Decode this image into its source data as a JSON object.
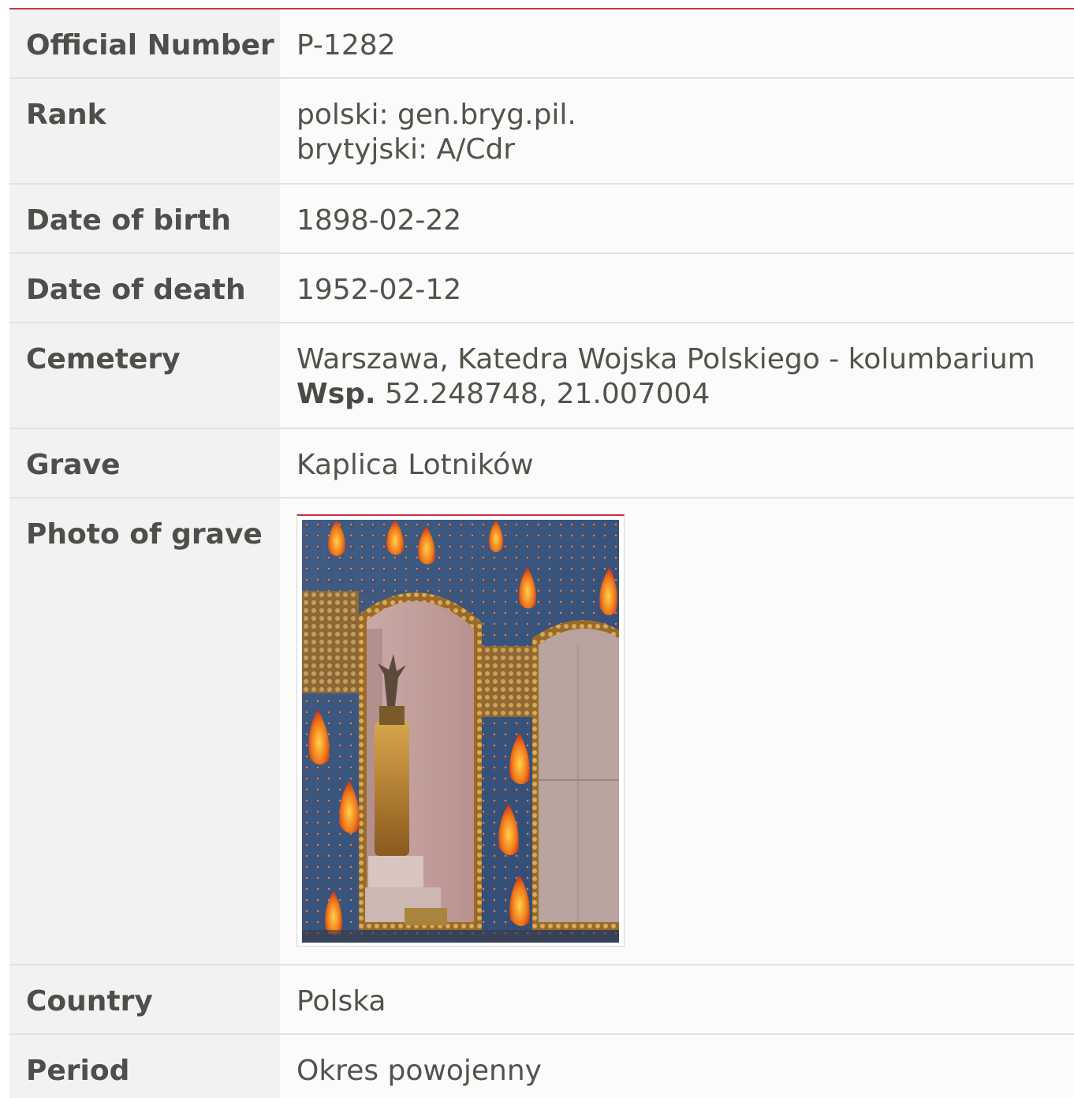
{
  "rows": {
    "official_number": {
      "label": "Official Number",
      "value": "P-1282"
    },
    "rank": {
      "label": "Rank",
      "line1": "polski: gen.bryg.pil.",
      "line2": "brytyjski: A/Cdr"
    },
    "date_of_birth": {
      "label": "Date of birth",
      "value": "1898-02-22"
    },
    "date_of_death": {
      "label": "Date of death",
      "value": "1952-02-12"
    },
    "cemetery": {
      "label": "Cemetery",
      "value": "Warszawa, Katedra Wojska Polskiego - kolumbarium",
      "coords_label": "Wsp.",
      "coords": "52.248748, 21.007004"
    },
    "grave": {
      "label": "Grave",
      "value": "Kaplica Lotników"
    },
    "photo_of_grave": {
      "label": "Photo of grave"
    },
    "country": {
      "label": "Country",
      "value": "Polska"
    },
    "period": {
      "label": "Period",
      "value": "Okres powojenny"
    }
  },
  "colors": {
    "accent": "#c8324c",
    "label_bg": "#f2f2f2",
    "value_bg": "#fbfbfb"
  }
}
